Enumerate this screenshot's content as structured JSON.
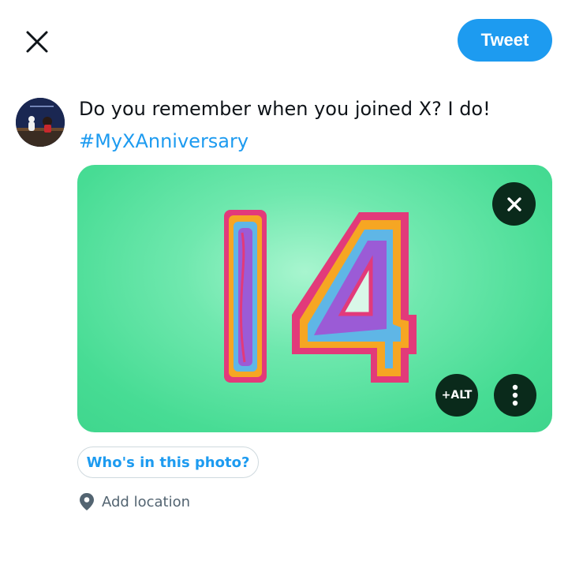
{
  "header": {
    "close_icon": "close-icon",
    "tweet_label": "Tweet",
    "accent_color": "#1d9bf0"
  },
  "composer": {
    "text": "Do you remember when you joined X? I do!",
    "hashtag": "#MyXAnniversary"
  },
  "media": {
    "image_subject": "14",
    "remove_icon": "close-icon",
    "alt_label": "+ALT",
    "more_icon": "more-vertical-icon"
  },
  "actions": {
    "tag_people_label": "Who's in this photo?",
    "location_icon": "location-pin-icon",
    "location_label": "Add location"
  }
}
